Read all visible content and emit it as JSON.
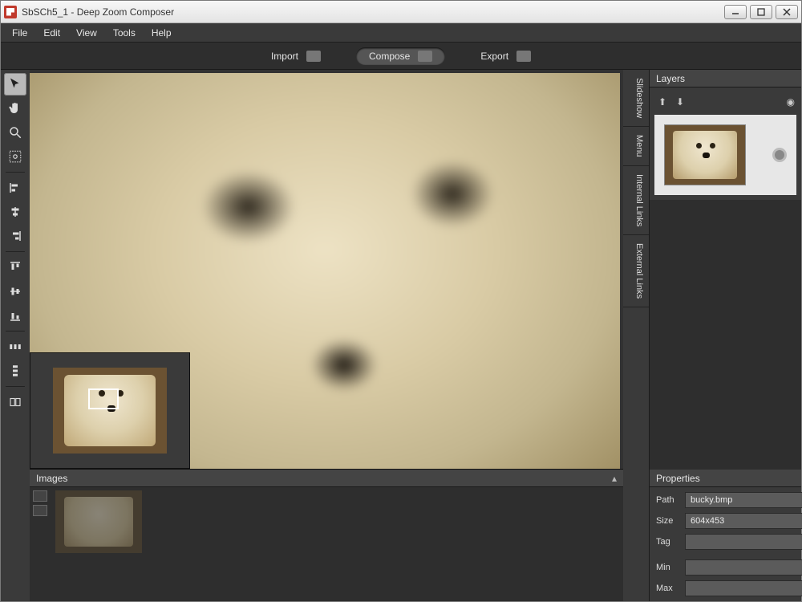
{
  "window": {
    "title": "SbSCh5_1 - Deep Zoom Composer"
  },
  "menu": {
    "file": "File",
    "edit": "Edit",
    "view": "View",
    "tools": "Tools",
    "help": "Help"
  },
  "modes": {
    "import": "Import",
    "compose": "Compose",
    "export": "Export",
    "active": "compose"
  },
  "rail": {
    "slideshow": "Slideshow",
    "menu": "Menu",
    "internal": "Internal Links",
    "external": "External Links"
  },
  "panels": {
    "layers": {
      "title": "Layers"
    },
    "images": {
      "title": "Images"
    },
    "properties": {
      "title": "Properties",
      "path_label": "Path",
      "path_value": "bucky.bmp",
      "size_label": "Size",
      "size_value": "604x453",
      "tag_label": "Tag",
      "tag_value": "",
      "min_label": "Min",
      "min_value": "",
      "max_label": "Max",
      "max_value": ""
    }
  }
}
